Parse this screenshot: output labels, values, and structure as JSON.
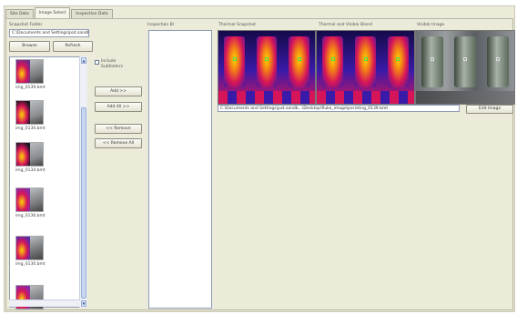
{
  "tabs": [
    {
      "label": "Site Data"
    },
    {
      "label": "Image Select"
    },
    {
      "label": "Inspection Data"
    }
  ],
  "left": {
    "snapshot_folder_label": "Snapshot Folder",
    "folder_path": "C:\\Documents and Settings\\pat.sandb...",
    "browse_label": "Browse",
    "refresh_label": "Refresh",
    "include_subfolders_label_1": "Include",
    "include_subfolders_label_2": "Subfolders",
    "include_subfolders_checked": false,
    "thumbnails": [
      {
        "name": "img_0139.bmt",
        "left": "#6e2a8a",
        "right": "#7c7f82"
      },
      {
        "name": "img_0130.bmt",
        "left": "#1a1622",
        "right": "#8b8f92"
      },
      {
        "name": "img_0134.bmt",
        "left": "#1a1622",
        "right": "#8b8f92"
      },
      {
        "name": "img_0136.bmt",
        "left": "#8a2aa8",
        "right": "#7a7d80"
      },
      {
        "name": "img_0130.bmt",
        "left": "#5a2aa8",
        "right": "#6f7275"
      },
      {
        "name": "",
        "left": "#8a2aa8",
        "right": "#7a7d80"
      }
    ]
  },
  "buttons": {
    "add_label": "Add >>",
    "add_all_label": "Add All >>",
    "remove_label": "<< Remove",
    "remove_all_label": "<< Remove All"
  },
  "inspection": {
    "label": "Inspection Bl"
  },
  "preview": {
    "thermal_label": "Thermal Snapshot",
    "blend_label": "Thermal and Visible Blend",
    "visible_label": "Visible Image",
    "image_path": "C:\\Documents and Settings\\pat.sandb...\\Desktop\\fluke_image\\peristing_0139.bmt",
    "edit_image_label": "Edit Image"
  },
  "colors": {
    "thermal_hot": "#ffd400",
    "thermal_mid": "#d6145a",
    "thermal_cool": "#3a1aa8",
    "thermal_cold": "#150a4a",
    "marker": "#4fd84f"
  }
}
